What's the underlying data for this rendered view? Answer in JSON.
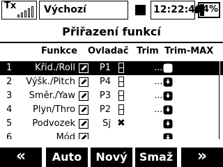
{
  "status": {
    "tx_label": "Tx",
    "signal_icon": "signal-bars-icon",
    "model_name": "Výchozí",
    "clock": "12:22:48",
    "battery_percent": "64%",
    "battery_level": 0.64
  },
  "screen": {
    "title": "Přiřazení funkcí"
  },
  "columns": {
    "function": "Funkce",
    "control": "Ovladač",
    "trim": "Trim",
    "trim_max": "Trim-MAX"
  },
  "rows": [
    {
      "num": "1",
      "function": "Křid./Roll",
      "control": "P1",
      "trim_type": "box",
      "trim_max": "..."
    },
    {
      "num": "2",
      "function": "Výšk./Pitch",
      "control": "P4",
      "trim_type": "box",
      "trim_max": "..."
    },
    {
      "num": "3",
      "function": "Směr./Yaw",
      "control": "P3",
      "trim_type": "box",
      "trim_max": "..."
    },
    {
      "num": "4",
      "function": "Plyn/Thro",
      "control": "P2",
      "trim_type": "box",
      "trim_max": "..."
    },
    {
      "num": "5",
      "function": "Podvozek",
      "control": "Sj",
      "trim_type": "none",
      "trim_max": ""
    },
    {
      "num": "6",
      "function": "Mód",
      "control": "",
      "trim_type": "none",
      "trim_max": ""
    }
  ],
  "buttons": {
    "prev": "«",
    "auto": "Auto",
    "new": "Nový",
    "delete": "Smaž",
    "next": "»"
  }
}
